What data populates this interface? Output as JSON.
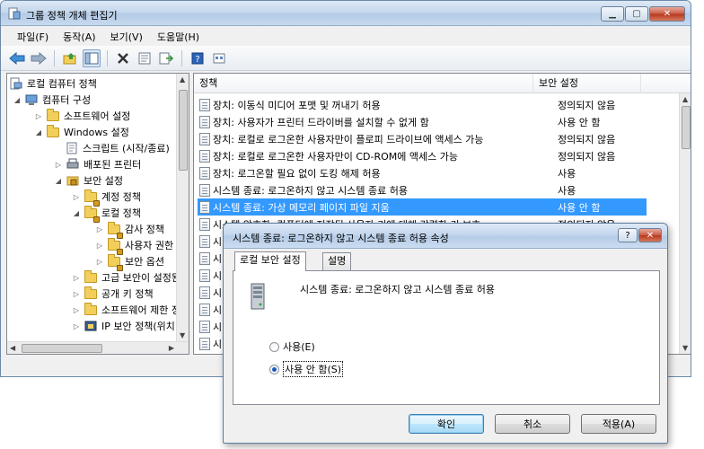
{
  "window": {
    "title": "그룹 정책 개체 편집기"
  },
  "menu": [
    "파일(F)",
    "동작(A)",
    "보기(V)",
    "도움말(H)"
  ],
  "toolbar": {
    "icons": [
      "back-arrow-icon",
      "forward-arrow-icon",
      "up-folder-icon",
      "show-hide-tree-icon",
      "delete-icon",
      "properties-icon",
      "export-list-icon",
      "help-icon",
      "view-icon"
    ]
  },
  "tree": [
    {
      "label": "로컬 컴퓨터 정책",
      "icon": "computer-policy-icon"
    },
    {
      "label": "컴퓨터 구성",
      "icon": "computer-icon"
    },
    {
      "label": "소프트웨어 설정",
      "icon": "folder-icon"
    },
    {
      "label": "Windows 설정",
      "icon": "folder-icon"
    },
    {
      "label": "스크립트 (시작/종료)",
      "icon": "script-icon"
    },
    {
      "label": "배포된 프린터",
      "icon": "printer-icon"
    },
    {
      "label": "보안 설정",
      "icon": "security-icon"
    },
    {
      "label": "계정 정책",
      "icon": "lock-folder-icon"
    },
    {
      "label": "로컬 정책",
      "icon": "lock-folder-icon"
    },
    {
      "label": "감사 정책",
      "icon": "lock-folder-icon"
    },
    {
      "label": "사용자 권한 할당",
      "icon": "lock-folder-icon"
    },
    {
      "label": "보안 옵션",
      "icon": "lock-folder-icon"
    },
    {
      "label": "고급 보안이 설정된 Windows 방화벽",
      "icon": "folder-icon"
    },
    {
      "label": "공개 키 정책",
      "icon": "folder-icon"
    },
    {
      "label": "소프트웨어 제한 정책",
      "icon": "folder-icon"
    },
    {
      "label": "IP 보안 정책(위치: 로컬 컴퓨터)",
      "icon": "ip-security-icon"
    }
  ],
  "list": {
    "columns": [
      "정책",
      "보안 설정"
    ],
    "rows": [
      {
        "name": "장치: 이동식 미디어 포맷 및 꺼내기 허용",
        "value": "정의되지 않음"
      },
      {
        "name": "장치: 사용자가 프린터 드라이버를 설치할 수 없게 함",
        "value": "사용 안 함"
      },
      {
        "name": "장치: 로컬로 로그온한 사용자만이 플로피 드라이브에 액세스 가능",
        "value": "정의되지 않음"
      },
      {
        "name": "장치: 로컬로 로그온한 사용자만이 CD-ROM에 액세스 가능",
        "value": "정의되지 않음"
      },
      {
        "name": "장치: 로그온할 필요 없이 도킹 해제 허용",
        "value": "사용"
      },
      {
        "name": "시스템 종료: 로그온하지 않고 시스템 종료 허용",
        "value": "사용"
      },
      {
        "name": "시스템 종료: 가상 메모리 페이지 파일 지움",
        "value": "사용 안 함"
      },
      {
        "name": "시스템 암호화: 컴퓨터에 저장된 사용자 키에 대해 강력한 키 보호",
        "value": "정의되지 않음"
      }
    ],
    "partial_rows": [
      "시",
      "시",
      "시",
      "시",
      "시",
      "시",
      "시",
      "시"
    ]
  },
  "dialog": {
    "title": "시스템 종료: 로그온하지 않고 시스템 종료 허용 속성",
    "tabs": [
      "로컬 보안 설정",
      "설명"
    ],
    "policy_name": "시스템 종료: 로그온하지 않고 시스템 종료 허용",
    "options": [
      {
        "label": "사용(E)",
        "checked": false
      },
      {
        "label": "사용 안 함(S)",
        "checked": true
      }
    ],
    "buttons": {
      "ok": "확인",
      "cancel": "취소",
      "apply": "적용(A)"
    },
    "help_glyph": "?",
    "close_glyph": "✕"
  },
  "colors": {
    "selection": "#3399ff",
    "titlebar": "#c3d6ec"
  }
}
